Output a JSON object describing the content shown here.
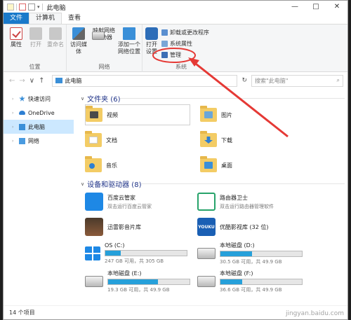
{
  "window": {
    "title": "此电脑",
    "controls": {
      "minimize": "—",
      "maximize": "□",
      "close": "✕"
    }
  },
  "quick_access": {
    "dropdown": "▾"
  },
  "ribbon": {
    "tabs": [
      {
        "label": "文件"
      },
      {
        "label": "计算机"
      },
      {
        "label": "查看"
      }
    ],
    "groups": {
      "location": {
        "label": "位置",
        "buttons": [
          {
            "label": "属性"
          },
          {
            "label": "打开"
          },
          {
            "label": "重命名"
          }
        ]
      },
      "network": {
        "label": "网络",
        "buttons": [
          {
            "label": "访问媒体"
          },
          {
            "label": "映射网络驱动器"
          },
          {
            "label": "添加一个网络位置"
          }
        ]
      },
      "system": {
        "label": "系统",
        "open_label": "打开设置",
        "small_buttons": [
          {
            "label": "卸载或更改程序"
          },
          {
            "label": "系统属性"
          },
          {
            "label": "管理"
          }
        ]
      }
    }
  },
  "address_bar": {
    "back": "←",
    "forward": "→",
    "recent": "∨",
    "up": "↑",
    "path": "此电脑",
    "refresh": "↻",
    "search_placeholder": "搜索\"此电脑\""
  },
  "sidebar": {
    "items": [
      {
        "label": "快速访问",
        "icon": "star-icon"
      },
      {
        "label": "OneDrive",
        "icon": "cloud-icon"
      },
      {
        "label": "此电脑",
        "icon": "pc-icon"
      },
      {
        "label": "网络",
        "icon": "network-icon"
      }
    ]
  },
  "folders_section": {
    "title": "文件夹 (6)",
    "items": [
      {
        "label": "视频",
        "icon": "video-folder-icon"
      },
      {
        "label": "图片",
        "icon": "pictures-folder-icon"
      },
      {
        "label": "文档",
        "icon": "documents-folder-icon"
      },
      {
        "label": "下载",
        "icon": "downloads-folder-icon"
      },
      {
        "label": "音乐",
        "icon": "music-folder-icon"
      },
      {
        "label": "桌面",
        "icon": "desktop-folder-icon"
      }
    ]
  },
  "devices_section": {
    "title": "设备和驱动器 (8)",
    "apps": [
      {
        "name": "百度云管家",
        "subtitle": "双击运行百度云管家"
      },
      {
        "name": "路由器卫士",
        "subtitle": "双击运行路由器管理软件"
      },
      {
        "name": "迅雷影音片库",
        "subtitle": ""
      },
      {
        "name": "优酷影视库 (32 位)",
        "subtitle": "",
        "icon_text": "YOUKU"
      }
    ],
    "drives": [
      {
        "name": "OS (C:)",
        "free": "247 GB 可用，共 305 GB",
        "used_fraction": 0.19
      },
      {
        "name": "本地磁盘 (D:)",
        "free": "30.5 GB 可用，共 49.9 GB",
        "used_fraction": 0.39
      },
      {
        "name": "本地磁盘 (E:)",
        "free": "19.3 GB 可用，共 49.9 GB",
        "used_fraction": 0.61
      },
      {
        "name": "本地磁盘 (F:)",
        "free": "36.6 GB 可用，共 49.9 GB",
        "used_fraction": 0.27
      }
    ]
  },
  "status_bar": {
    "count": "14 个项目"
  },
  "watermark": "jingyan.baidu.com",
  "colors": {
    "accent": "#1979ca",
    "annotation": "#e53935",
    "bar": "#26a0da"
  }
}
